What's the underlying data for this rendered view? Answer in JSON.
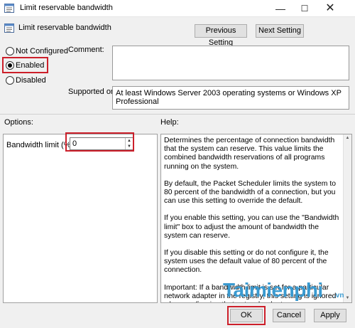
{
  "window": {
    "title": "Limit reservable bandwidth",
    "minimize_glyph": "—",
    "maximize_glyph": "☐",
    "close_glyph": "✕"
  },
  "header": {
    "policy_name": "Limit reservable bandwidth",
    "icon": "policy-setting-icon"
  },
  "nav": {
    "previous_label": "Previous Setting",
    "next_label": "Next Setting"
  },
  "state": {
    "options": [
      {
        "label": "Not Configured",
        "selected": false
      },
      {
        "label": "Enabled",
        "selected": true
      },
      {
        "label": "Disabled",
        "selected": false
      }
    ]
  },
  "comment": {
    "label": "Comment:",
    "value": ""
  },
  "supported": {
    "label": "Supported on:",
    "value": "At least Windows Server 2003 operating systems or Windows XP Professional"
  },
  "options_section": {
    "label": "Options:",
    "bandwidth_label": "Bandwidth limit (%):",
    "bandwidth_value": "0"
  },
  "help_section": {
    "label": "Help:",
    "paragraphs": [
      "Determines the percentage of connection bandwidth that the system can reserve. This value limits the combined bandwidth reservations of all programs running on the system.",
      "By default, the Packet Scheduler limits the system to 80 percent of the bandwidth of a connection, but you can use this setting to override the default.",
      "If you enable this setting, you can use the \"Bandwidth limit\" box to adjust the amount of bandwidth the system can reserve.",
      "If you disable this setting or do not configure it, the system uses the default value of 80 percent of the connection.",
      "Important: If a bandwidth limit is set for a particular network adapter in the registry, this setting is ignored when configuring that network adapter."
    ]
  },
  "watermark": {
    "text": "Taimienphi",
    "suffix": ".vn"
  },
  "footer": {
    "ok_label": "OK",
    "cancel_label": "Cancel",
    "apply_label": "Apply"
  },
  "colors": {
    "highlight": "#cc1f2a",
    "watermark": "#3a9ad0"
  }
}
